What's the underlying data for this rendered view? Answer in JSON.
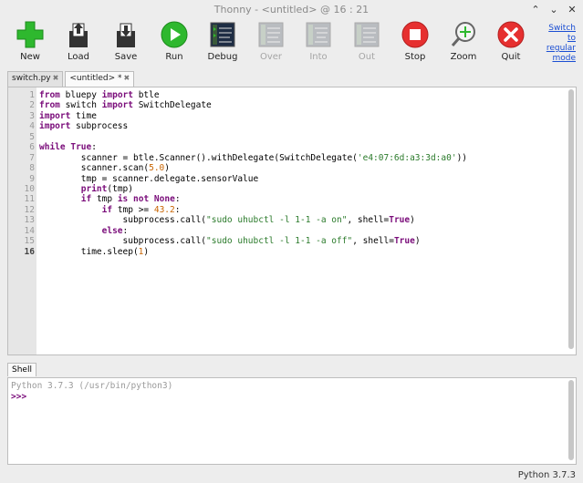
{
  "window": {
    "title": "Thonny  -  <untitled>  @  16 : 21",
    "controls": [
      "chevron-up",
      "chevron-down",
      "close"
    ]
  },
  "toolbar": {
    "buttons": [
      {
        "label": "New",
        "icon": "new-file-icon",
        "enabled": true
      },
      {
        "label": "Load",
        "icon": "load-icon",
        "enabled": true
      },
      {
        "label": "Save",
        "icon": "save-icon",
        "enabled": true
      },
      {
        "label": "Run",
        "icon": "run-icon",
        "enabled": true
      },
      {
        "label": "Debug",
        "icon": "debug-icon",
        "enabled": true
      },
      {
        "label": "Over",
        "icon": "step-over-icon",
        "enabled": false
      },
      {
        "label": "Into",
        "icon": "step-into-icon",
        "enabled": false
      },
      {
        "label": "Out",
        "icon": "step-out-icon",
        "enabled": false
      },
      {
        "label": "Stop",
        "icon": "stop-icon",
        "enabled": true
      },
      {
        "label": "Zoom",
        "icon": "zoom-icon",
        "enabled": true
      },
      {
        "label": "Quit",
        "icon": "quit-icon",
        "enabled": true
      }
    ],
    "switch_mode": "Switch to regular mode"
  },
  "editor": {
    "tabs": [
      {
        "label": "switch.py",
        "active": false
      },
      {
        "label": "<untitled> *",
        "active": true
      }
    ],
    "close_glyph": "✖",
    "current_line": 16,
    "line_numbers": [
      "1",
      "2",
      "3",
      "4",
      "5",
      "6",
      "7",
      "8",
      "9",
      "10",
      "11",
      "12",
      "13",
      "14",
      "15",
      "16"
    ],
    "lines": [
      "from bluepy import btle",
      "from switch import SwitchDelegate",
      "import time",
      "import subprocess",
      "",
      "while True:",
      "        scanner = btle.Scanner().withDelegate(SwitchDelegate('e4:07:6d:a3:3d:a0'))",
      "        scanner.scan(5.0)",
      "        tmp = scanner.delegate.sensorValue",
      "        print(tmp)",
      "        if tmp is not None:",
      "            if tmp >= 43.2:",
      "                subprocess.call(\"sudo uhubctl -l 1-1 -a on\", shell=True)",
      "            else:",
      "                subprocess.call(\"sudo uhubctl -l 1-1 -a off\", shell=True)",
      "        time.sleep(1)"
    ]
  },
  "shell": {
    "tab_label": "Shell",
    "banner": "Python 3.7.3 (/usr/bin/python3)",
    "prompt": ">>>"
  },
  "status_bar": {
    "interpreter": "Python 3.7.3"
  },
  "colors": {
    "keyword": "#7a0c7a",
    "string": "#2a7a2a",
    "number": "#c86400",
    "link": "#1a4ed3"
  }
}
